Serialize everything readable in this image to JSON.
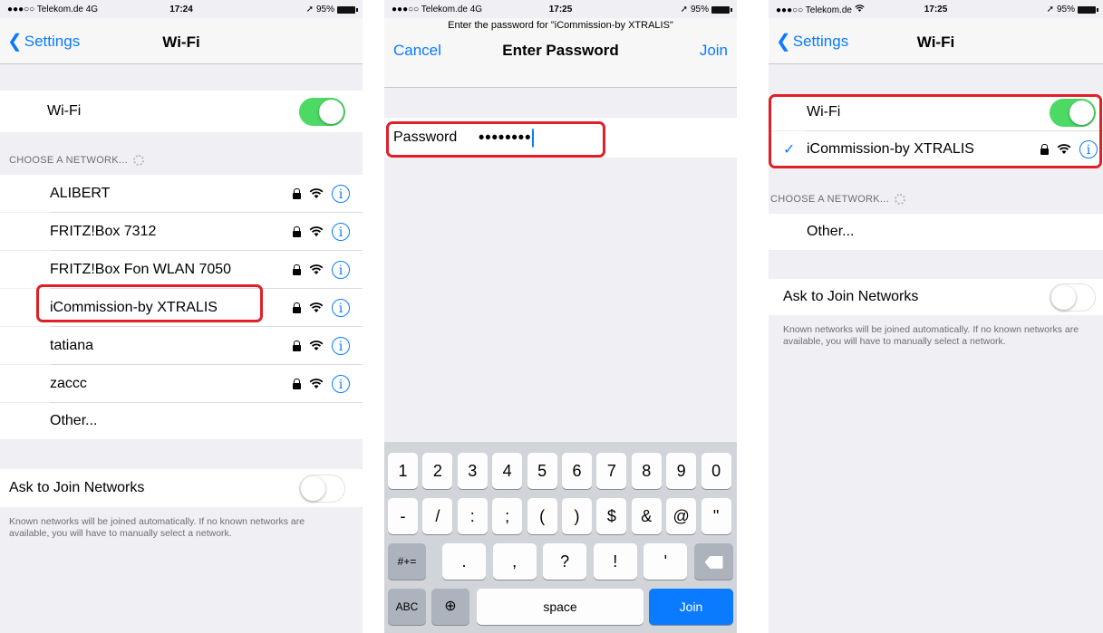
{
  "colors": {
    "accent": "#0a7aff",
    "toggle_on": "#4cd964",
    "highlight": "#e01f26",
    "group_bg": "#efeff4"
  },
  "screen1": {
    "status": {
      "carrier": "●●●○○ Telekom.de  4G",
      "time": "17:24",
      "battery": "95%"
    },
    "nav": {
      "back": "Settings",
      "title": "Wi-Fi"
    },
    "wifi_label": "Wi-Fi",
    "wifi_on": true,
    "choose_header": "CHOOSE A NETWORK...",
    "networks": [
      {
        "name": "ALIBERT"
      },
      {
        "name": "FRITZ!Box 7312"
      },
      {
        "name": "FRITZ!Box Fon WLAN 7050"
      },
      {
        "name": "iCommission-by XTRALIS"
      },
      {
        "name": "tatiana"
      },
      {
        "name": "zaccc"
      }
    ],
    "other": "Other...",
    "ask_label": "Ask to Join Networks",
    "ask_on": false,
    "footer": "Known networks will be joined automatically. If no known networks are available, you will have to manually select a network."
  },
  "screen2": {
    "status": {
      "carrier": "●●●○○ Telekom.de  4G",
      "time": "17:25",
      "battery": "95%"
    },
    "prompt": "Enter the password for \"iCommission-by XTRALIS\"",
    "cancel": "Cancel",
    "title": "Enter Password",
    "join": "Join",
    "password_label": "Password",
    "password_value": "••••••••",
    "keyboard": {
      "row1": [
        "1",
        "2",
        "3",
        "4",
        "5",
        "6",
        "7",
        "8",
        "9",
        "0"
      ],
      "row2": [
        "-",
        "/",
        ":",
        ";",
        "(",
        ")",
        "$",
        "&",
        "@",
        "\""
      ],
      "row3": [
        ".",
        ",",
        "?",
        "!",
        "'"
      ],
      "more_key": "#+=",
      "abc_key": "ABC",
      "space_key": "space",
      "join_key": "Join"
    }
  },
  "screen3": {
    "status": {
      "carrier": "●●●○○ Telekom.de",
      "time": "17:25",
      "battery": "95%"
    },
    "nav": {
      "back": "Settings",
      "title": "Wi-Fi"
    },
    "wifi_label": "Wi-Fi",
    "wifi_on": true,
    "connected_check": "✓",
    "connected_network": "iCommission-by XTRALIS",
    "choose_header": "CHOOSE A NETWORK...",
    "other": "Other...",
    "ask_label": "Ask to Join Networks",
    "ask_on": false,
    "footer": "Known networks will be joined automatically. If no known networks are available, you will have to manually select a network."
  }
}
